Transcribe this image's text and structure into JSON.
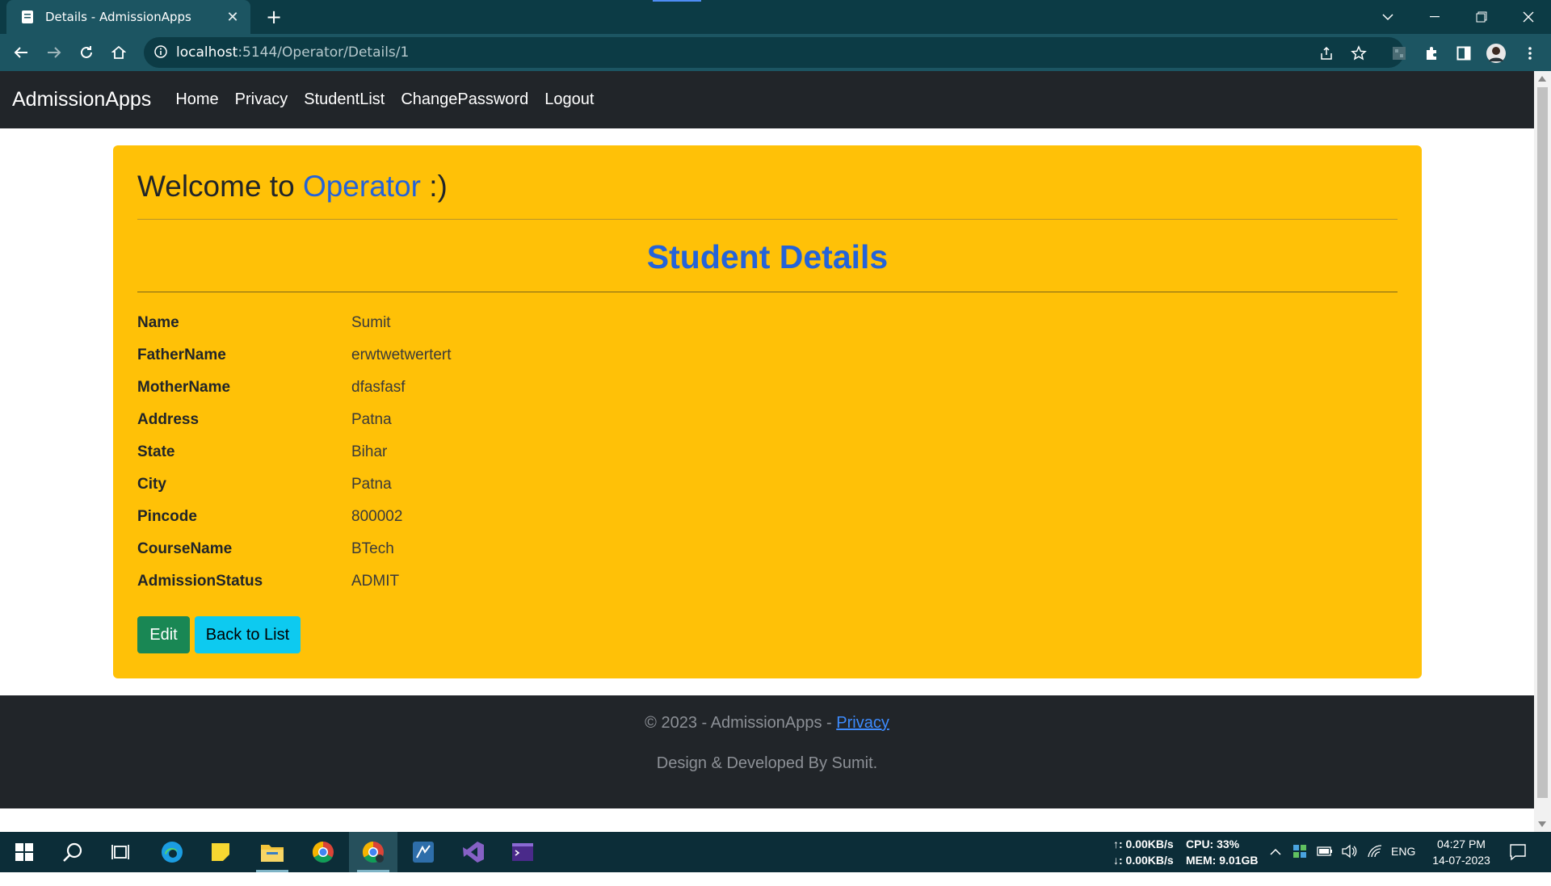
{
  "browser": {
    "tab_title": "Details - AdmissionApps",
    "tab_close": "✕",
    "new_tab": "+",
    "url_host": "localhost",
    "url_path": ":5144/Operator/Details/1"
  },
  "app": {
    "brand": "AdmissionApps",
    "nav": [
      "Home",
      "Privacy",
      "StudentList",
      "ChangePassword",
      "Logout"
    ]
  },
  "main": {
    "welcome_prefix": "Welcome to ",
    "welcome_role": "Operator",
    "welcome_suffix": " :)",
    "section_title": "Student Details",
    "fields": [
      {
        "label": "Name",
        "value": "Sumit"
      },
      {
        "label": "FatherName",
        "value": "erwtwetwertert"
      },
      {
        "label": "MotherName",
        "value": "dfasfasf"
      },
      {
        "label": "Address",
        "value": "Patna"
      },
      {
        "label": "State",
        "value": "Bihar"
      },
      {
        "label": "City",
        "value": "Patna"
      },
      {
        "label": "Pincode",
        "value": "800002"
      },
      {
        "label": "CourseName",
        "value": "BTech"
      },
      {
        "label": "AdmissionStatus",
        "value": "ADMIT"
      }
    ],
    "edit_label": "Edit",
    "back_label": "Back to List"
  },
  "footer": {
    "copyright": "© 2023 - AdmissionApps - ",
    "privacy_link": "Privacy",
    "credit": "Design & Developed By Sumit."
  },
  "taskbar": {
    "net_up": "↑: 0.00KB/s",
    "net_down": "↓: 0.00KB/s",
    "cpu": "CPU: 33%",
    "mem": "MEM: 9.01GB",
    "lang": "ENG",
    "time": "04:27 PM",
    "date": "14-07-2023"
  },
  "colors": {
    "card": "#ffc107",
    "accent_blue": "#2463d9",
    "nav_dark": "#212529",
    "edit_btn": "#198754",
    "back_btn": "#0dcaf0"
  }
}
